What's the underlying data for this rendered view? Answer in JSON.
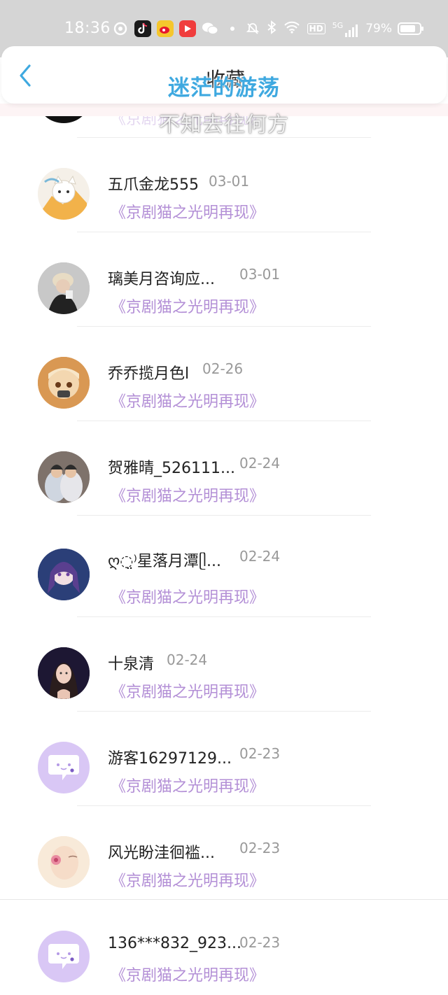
{
  "status_bar": {
    "time": "18:36",
    "battery_percent": "79%",
    "battery_level": 0.79,
    "network_label": "5G",
    "hd_label": "HD"
  },
  "header": {
    "back_icon": "chevron-left-icon",
    "title": "收藏"
  },
  "overlay": {
    "title": "迷茫的游荡",
    "subtitle": "不知去往何方"
  },
  "colors": {
    "accent": "#3fa9e0",
    "work_title": "#b38fd6",
    "guest_avatar_bg": "#d9c7f5"
  },
  "favorites": [
    {
      "name": "五爪金龙555",
      "date": "03-01",
      "work": "《京剧猫之光明再现》",
      "avatar": "anime-cat-avatar"
    },
    {
      "name": "璃美月咨询应...",
      "date": "03-01",
      "work": "《京剧猫之光明再现》",
      "avatar": "photo-avatar"
    },
    {
      "name": "乔乔揽月色l",
      "date": "02-26",
      "work": "《京剧猫之光明再现》",
      "avatar": "anime-girl-avatar"
    },
    {
      "name": "贺雅晴_526111...",
      "date": "02-24",
      "work": "《京剧猫之光明再现》",
      "avatar": "couple-photo-avatar"
    },
    {
      "name": "ღ◌̤⁾星落月潭ᥫ...",
      "date": "02-24",
      "work": "《京剧猫之光明再现》",
      "avatar": "anime-character-avatar"
    },
    {
      "name": "十泉清",
      "date": "02-24",
      "work": "《京剧猫之光明再现》",
      "avatar": "portrait-avatar"
    },
    {
      "name": "游客16297129...",
      "date": "02-23",
      "work": "《京剧猫之光明再现》",
      "avatar": "guest-chat-avatar"
    },
    {
      "name": "风光盼洼徊褴...",
      "date": "02-23",
      "work": "《京剧猫之光明再现》",
      "avatar": "illustration-avatar"
    },
    {
      "name": "136***832_923...",
      "date": "02-23",
      "work": "《京剧猫之光明再现》",
      "avatar": "guest-chat-avatar"
    }
  ],
  "partial_top_row": {
    "work": "《京剧猫之光明再现》"
  }
}
